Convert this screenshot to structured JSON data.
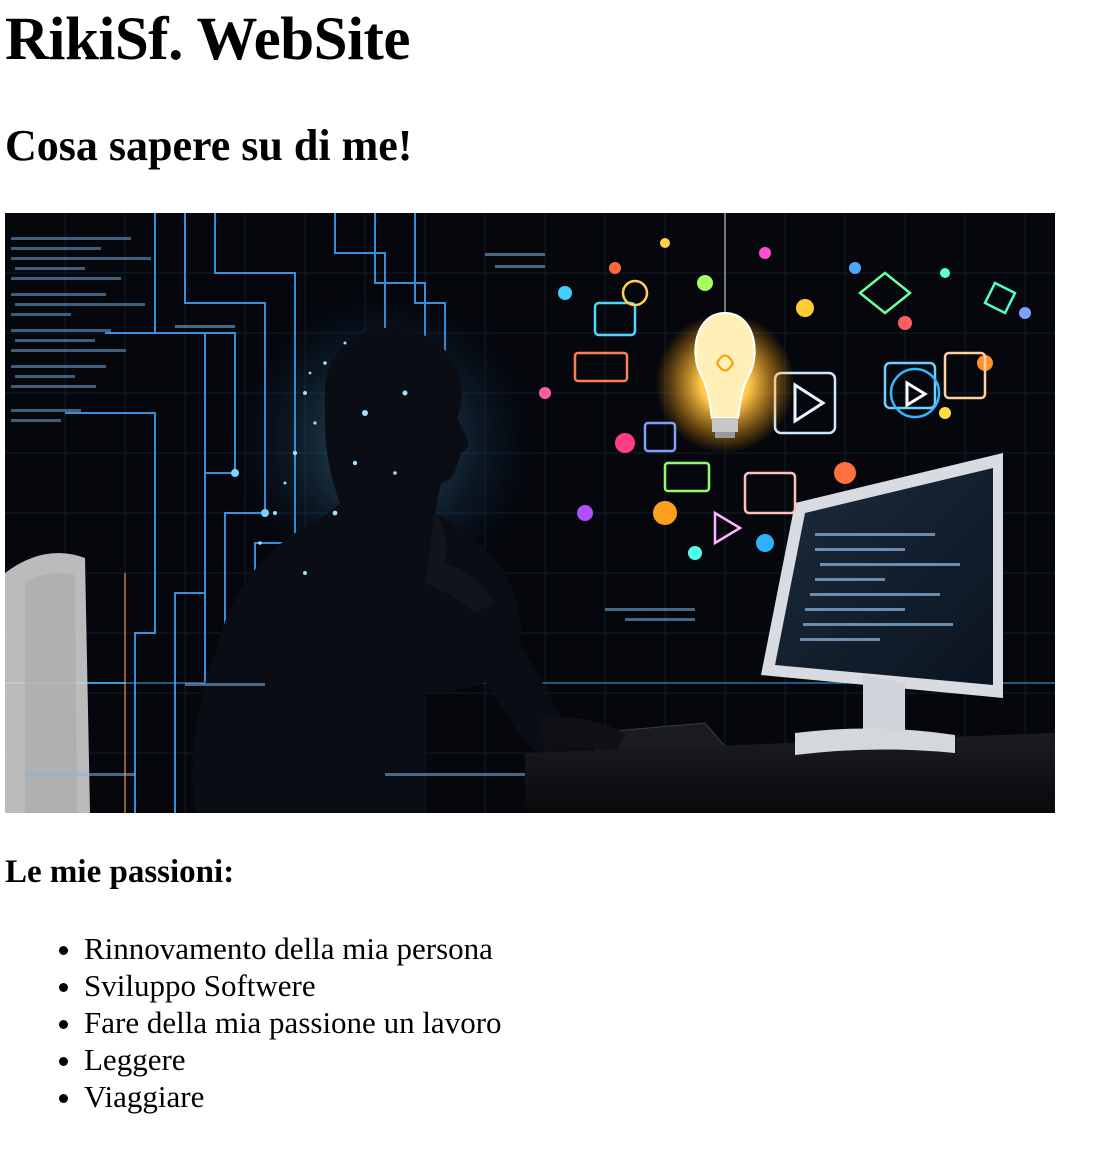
{
  "page": {
    "title": "RikiSf. WebSite",
    "subtitle": "Cosa sapere su di me!",
    "hero_image": {
      "alt": "",
      "icon": "person-at-computer-illustration"
    },
    "passions_heading": "Le mie passioni:",
    "passions": [
      "Rinnovamento della mia persona",
      "Sviluppo Softwere",
      "Fare della mia passione un lavoro",
      "Leggere",
      "Viaggiare"
    ]
  },
  "colors": {
    "background": "#ffffff",
    "text": "#000000",
    "hero_background": "#05070d",
    "circuit_blue": "#3fa9ff",
    "bulb_glow": "#ffcc55"
  }
}
